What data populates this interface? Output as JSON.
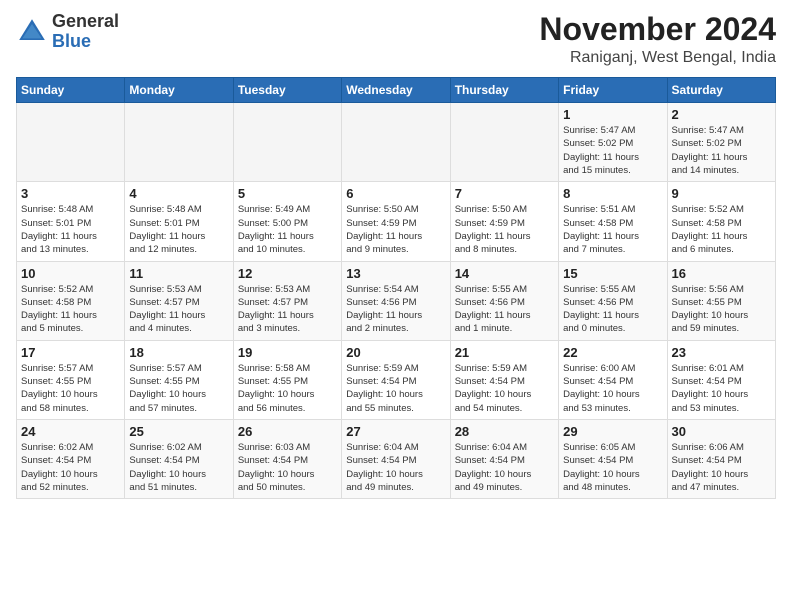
{
  "header": {
    "logo_general": "General",
    "logo_blue": "Blue",
    "title": "November 2024",
    "location": "Raniganj, West Bengal, India"
  },
  "weekdays": [
    "Sunday",
    "Monday",
    "Tuesday",
    "Wednesday",
    "Thursday",
    "Friday",
    "Saturday"
  ],
  "weeks": [
    [
      {
        "day": "",
        "detail": ""
      },
      {
        "day": "",
        "detail": ""
      },
      {
        "day": "",
        "detail": ""
      },
      {
        "day": "",
        "detail": ""
      },
      {
        "day": "",
        "detail": ""
      },
      {
        "day": "1",
        "detail": "Sunrise: 5:47 AM\nSunset: 5:02 PM\nDaylight: 11 hours\nand 15 minutes."
      },
      {
        "day": "2",
        "detail": "Sunrise: 5:47 AM\nSunset: 5:02 PM\nDaylight: 11 hours\nand 14 minutes."
      }
    ],
    [
      {
        "day": "3",
        "detail": "Sunrise: 5:48 AM\nSunset: 5:01 PM\nDaylight: 11 hours\nand 13 minutes."
      },
      {
        "day": "4",
        "detail": "Sunrise: 5:48 AM\nSunset: 5:01 PM\nDaylight: 11 hours\nand 12 minutes."
      },
      {
        "day": "5",
        "detail": "Sunrise: 5:49 AM\nSunset: 5:00 PM\nDaylight: 11 hours\nand 10 minutes."
      },
      {
        "day": "6",
        "detail": "Sunrise: 5:50 AM\nSunset: 4:59 PM\nDaylight: 11 hours\nand 9 minutes."
      },
      {
        "day": "7",
        "detail": "Sunrise: 5:50 AM\nSunset: 4:59 PM\nDaylight: 11 hours\nand 8 minutes."
      },
      {
        "day": "8",
        "detail": "Sunrise: 5:51 AM\nSunset: 4:58 PM\nDaylight: 11 hours\nand 7 minutes."
      },
      {
        "day": "9",
        "detail": "Sunrise: 5:52 AM\nSunset: 4:58 PM\nDaylight: 11 hours\nand 6 minutes."
      }
    ],
    [
      {
        "day": "10",
        "detail": "Sunrise: 5:52 AM\nSunset: 4:58 PM\nDaylight: 11 hours\nand 5 minutes."
      },
      {
        "day": "11",
        "detail": "Sunrise: 5:53 AM\nSunset: 4:57 PM\nDaylight: 11 hours\nand 4 minutes."
      },
      {
        "day": "12",
        "detail": "Sunrise: 5:53 AM\nSunset: 4:57 PM\nDaylight: 11 hours\nand 3 minutes."
      },
      {
        "day": "13",
        "detail": "Sunrise: 5:54 AM\nSunset: 4:56 PM\nDaylight: 11 hours\nand 2 minutes."
      },
      {
        "day": "14",
        "detail": "Sunrise: 5:55 AM\nSunset: 4:56 PM\nDaylight: 11 hours\nand 1 minute."
      },
      {
        "day": "15",
        "detail": "Sunrise: 5:55 AM\nSunset: 4:56 PM\nDaylight: 11 hours\nand 0 minutes."
      },
      {
        "day": "16",
        "detail": "Sunrise: 5:56 AM\nSunset: 4:55 PM\nDaylight: 10 hours\nand 59 minutes."
      }
    ],
    [
      {
        "day": "17",
        "detail": "Sunrise: 5:57 AM\nSunset: 4:55 PM\nDaylight: 10 hours\nand 58 minutes."
      },
      {
        "day": "18",
        "detail": "Sunrise: 5:57 AM\nSunset: 4:55 PM\nDaylight: 10 hours\nand 57 minutes."
      },
      {
        "day": "19",
        "detail": "Sunrise: 5:58 AM\nSunset: 4:55 PM\nDaylight: 10 hours\nand 56 minutes."
      },
      {
        "day": "20",
        "detail": "Sunrise: 5:59 AM\nSunset: 4:54 PM\nDaylight: 10 hours\nand 55 minutes."
      },
      {
        "day": "21",
        "detail": "Sunrise: 5:59 AM\nSunset: 4:54 PM\nDaylight: 10 hours\nand 54 minutes."
      },
      {
        "day": "22",
        "detail": "Sunrise: 6:00 AM\nSunset: 4:54 PM\nDaylight: 10 hours\nand 53 minutes."
      },
      {
        "day": "23",
        "detail": "Sunrise: 6:01 AM\nSunset: 4:54 PM\nDaylight: 10 hours\nand 53 minutes."
      }
    ],
    [
      {
        "day": "24",
        "detail": "Sunrise: 6:02 AM\nSunset: 4:54 PM\nDaylight: 10 hours\nand 52 minutes."
      },
      {
        "day": "25",
        "detail": "Sunrise: 6:02 AM\nSunset: 4:54 PM\nDaylight: 10 hours\nand 51 minutes."
      },
      {
        "day": "26",
        "detail": "Sunrise: 6:03 AM\nSunset: 4:54 PM\nDaylight: 10 hours\nand 50 minutes."
      },
      {
        "day": "27",
        "detail": "Sunrise: 6:04 AM\nSunset: 4:54 PM\nDaylight: 10 hours\nand 49 minutes."
      },
      {
        "day": "28",
        "detail": "Sunrise: 6:04 AM\nSunset: 4:54 PM\nDaylight: 10 hours\nand 49 minutes."
      },
      {
        "day": "29",
        "detail": "Sunrise: 6:05 AM\nSunset: 4:54 PM\nDaylight: 10 hours\nand 48 minutes."
      },
      {
        "day": "30",
        "detail": "Sunrise: 6:06 AM\nSunset: 4:54 PM\nDaylight: 10 hours\nand 47 minutes."
      }
    ]
  ]
}
